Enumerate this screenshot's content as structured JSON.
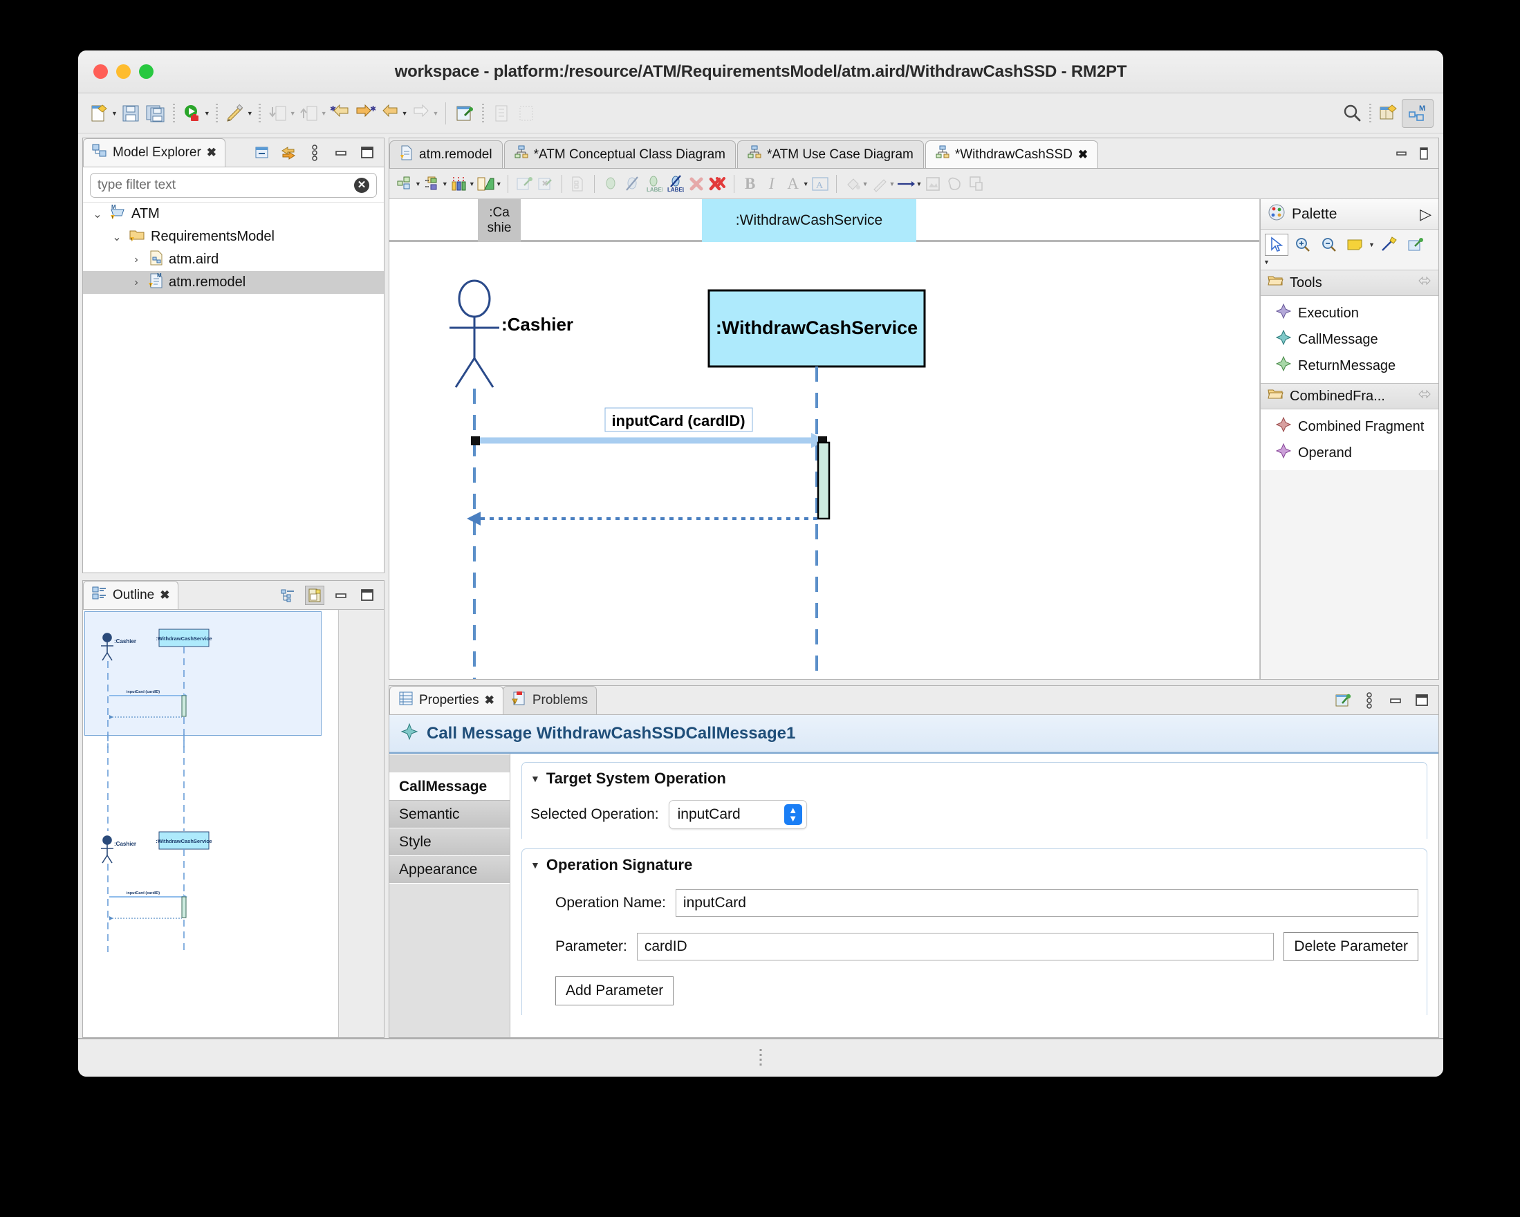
{
  "window": {
    "title": "workspace - platform:/resource/ATM/RequirementsModel/atm.aird/WithdrawCashSSD - RM2PT"
  },
  "model_explorer": {
    "tab_label": "Model Explorer",
    "filter_placeholder": "type filter text",
    "tree": [
      {
        "label": "ATM",
        "depth": 0,
        "twist": "⌄",
        "icon": "model-icon",
        "selected": false
      },
      {
        "label": "RequirementsModel",
        "depth": 1,
        "twist": "⌄",
        "icon": "folder-icon",
        "selected": false
      },
      {
        "label": "atm.aird",
        "depth": 2,
        "twist": "›",
        "icon": "aird-file-icon",
        "selected": false
      },
      {
        "label": "atm.remodel",
        "depth": 2,
        "twist": "›",
        "icon": "remodel-file-icon",
        "selected": true
      }
    ]
  },
  "outline": {
    "tab_label": "Outline",
    "thumbnail": {
      "actor_label": ":Cashier",
      "service_label": ":WithdrawCashService",
      "message_label": "inputCard (cardID)"
    }
  },
  "editor": {
    "tabs": [
      {
        "label": "atm.remodel",
        "active": false,
        "dirty": false,
        "icon": "remodel-file-icon"
      },
      {
        "label": "*ATM Conceptual Class Diagram",
        "active": false,
        "dirty": true,
        "icon": "diagram-icon"
      },
      {
        "label": "*ATM Use Case Diagram",
        "active": false,
        "dirty": true,
        "icon": "diagram-icon"
      },
      {
        "label": "*WithdrawCashSSD",
        "active": true,
        "dirty": true,
        "icon": "diagram-icon"
      }
    ]
  },
  "diagram": {
    "sticky_header": {
      "cashier_line1": ":Ca",
      "cashier_line2": "shie",
      "service_label": ":WithdrawCashService"
    },
    "actor_label": ":Cashier",
    "service_label": ":WithdrawCashService",
    "call_message_label": "inputCard (cardID)",
    "colors": {
      "lifeline_box_fill": "#aeeafc",
      "lifeline_line": "#5b8fc9",
      "selected_message": "#a8cdf0",
      "execution_fill": "#cdeadf"
    }
  },
  "palette": {
    "title": "Palette",
    "groups": [
      {
        "name": "Tools",
        "items": [
          {
            "label": "Execution",
            "icon": "execution-tool-icon",
            "color": "#9b8ec4"
          },
          {
            "label": "CallMessage",
            "icon": "call-message-tool-icon",
            "color": "#3aa6a6"
          },
          {
            "label": "ReturnMessage",
            "icon": "return-message-tool-icon",
            "color": "#7fbf7f"
          }
        ]
      },
      {
        "name": "CombinedFra...",
        "items": [
          {
            "label": "Combined Fragment",
            "icon": "combined-fragment-tool-icon",
            "color": "#c06a6a"
          },
          {
            "label": "Operand",
            "icon": "operand-tool-icon",
            "color": "#b06ac0"
          }
        ]
      }
    ]
  },
  "properties": {
    "tabs": [
      {
        "label": "Properties",
        "active": true,
        "icon": "properties-icon"
      },
      {
        "label": "Problems",
        "active": false,
        "icon": "problems-icon"
      }
    ],
    "header_title": "Call Message WithdrawCashSSDCallMessage1",
    "side_tabs": [
      {
        "label": "CallMessage",
        "active": true
      },
      {
        "label": "Semantic",
        "active": false
      },
      {
        "label": "Style",
        "active": false
      },
      {
        "label": "Appearance",
        "active": false
      }
    ],
    "section_target": {
      "title": "Target System Operation",
      "selected_operation_label": "Selected Operation:",
      "selected_operation_value": "inputCard"
    },
    "section_signature": {
      "title": "Operation Signature",
      "operation_name_label": "Operation Name:",
      "operation_name_value": "inputCard",
      "parameter_label": "Parameter:",
      "parameter_value": "cardID",
      "delete_parameter_label": "Delete Parameter",
      "add_parameter_label": "Add Parameter"
    }
  }
}
